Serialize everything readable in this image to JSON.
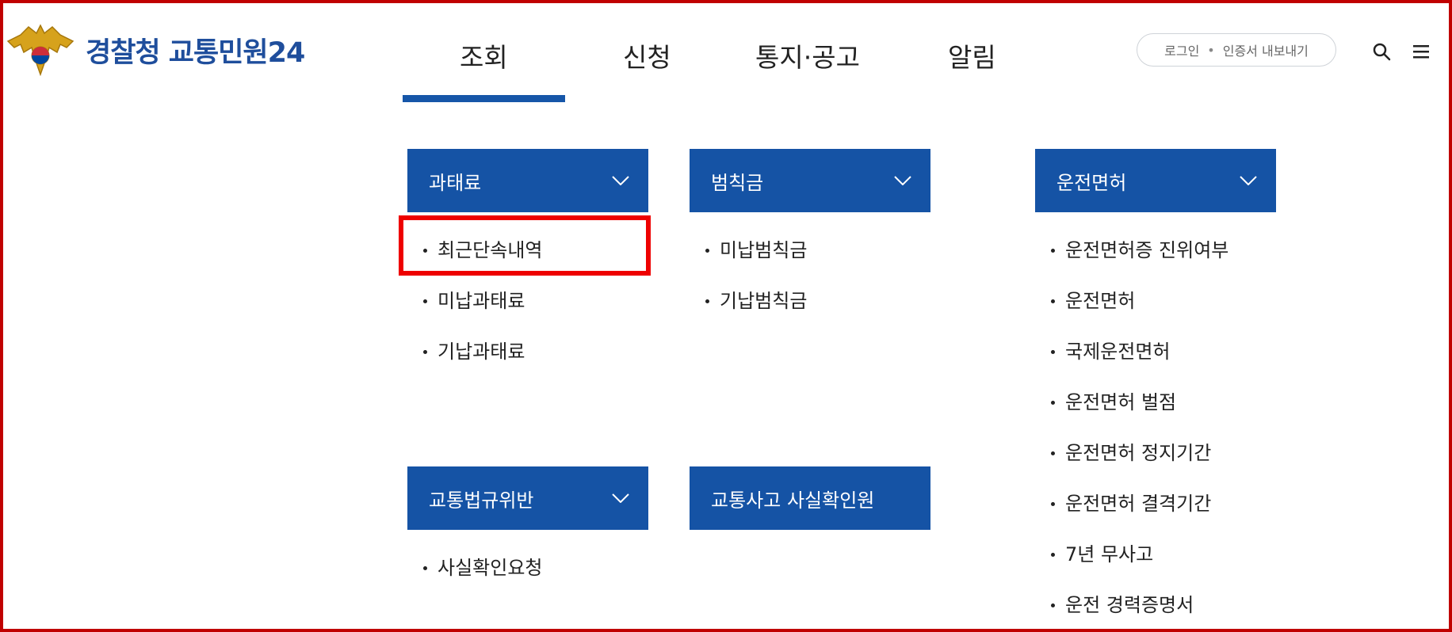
{
  "header": {
    "logo_text_main": "경찰청",
    "logo_text_sub": "교통민원24",
    "nav": [
      "조회",
      "신청",
      "통지·공고",
      "알림"
    ],
    "active_nav_index": 0,
    "auth": {
      "login": "로그인",
      "separator": "•",
      "cert_export": "인증서 내보내기"
    }
  },
  "mega_menu": {
    "categories": [
      {
        "title": "과태료",
        "items": [
          "최근단속내역",
          "미납과태료",
          "기납과태료"
        ]
      },
      {
        "title": "범칙금",
        "items": [
          "미납범칙금",
          "기납범칙금"
        ]
      },
      {
        "title": "운전면허",
        "items": [
          "운전면허증 진위여부",
          "운전면허",
          "국제운전면허",
          "운전면허 벌점",
          "운전면허 정지기간",
          "운전면허 결격기간",
          "7년 무사고",
          "운전 경력증명서"
        ]
      },
      {
        "title": "교통법규위반",
        "items": [
          "사실확인요청"
        ]
      },
      {
        "title": "교통사고 사실확인원",
        "items": []
      }
    ],
    "highlighted_item": "최근단속내역"
  },
  "colors": {
    "accent": "#1553a5",
    "active_bar": "#1656a8",
    "highlight_border": "#ee0000",
    "frame_border": "#c00000",
    "logo_text": "#1f4e9c"
  },
  "icons": [
    "police-emblem-icon",
    "search-icon",
    "hamburger-menu-icon",
    "chevron-down-icon"
  ]
}
